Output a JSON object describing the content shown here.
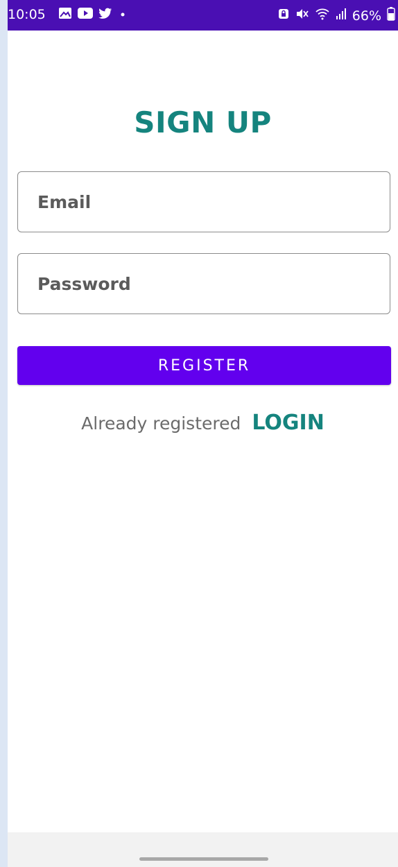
{
  "status_bar": {
    "time": "10:05",
    "left_icons": [
      "image-icon",
      "youtube-icon",
      "twitter-icon",
      "dot-icon"
    ],
    "right_icons": [
      "lock-icon",
      "mute-icon",
      "wifi-icon",
      "signal-icon"
    ],
    "battery": "66%"
  },
  "screen": {
    "title": "SIGN UP",
    "email_placeholder": "Email",
    "password_placeholder": "Password",
    "register_label": "REGISTER",
    "already_text": "Already registered",
    "login_label": "LOGIN"
  },
  "colors": {
    "status_bar": "#4a0fb3",
    "accent_teal": "#15847e",
    "button_purple": "#6200ee",
    "page_background": "#dce6f4"
  }
}
